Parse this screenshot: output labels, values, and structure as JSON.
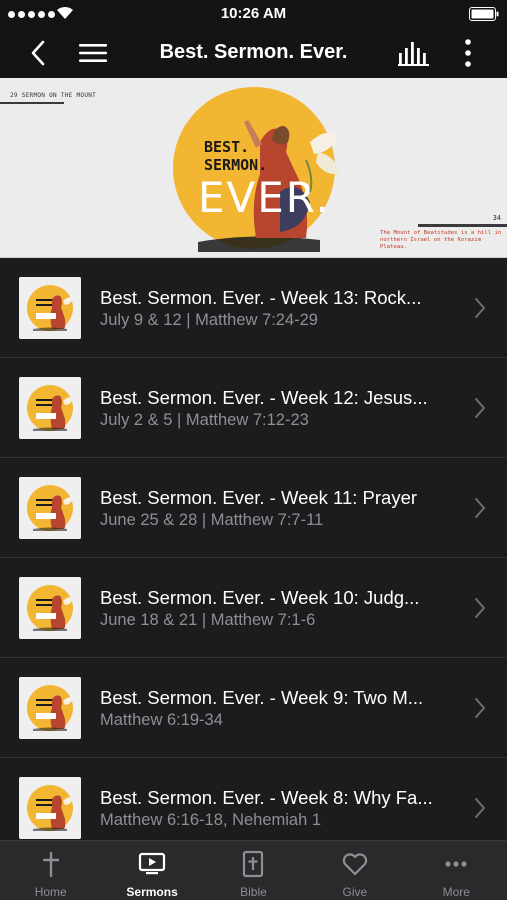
{
  "status_bar": {
    "time": "10:26 AM"
  },
  "nav": {
    "title": "Best. Sermon. Ever.",
    "back_icon": "chevron-left-icon",
    "menu_icon": "hamburger-icon",
    "chart_icon": "bars-icon",
    "more_icon": "vertical-dots-icon"
  },
  "banner": {
    "series_tag": "29 SERMON ON THE MOUNT",
    "art_line1": "BEST.",
    "art_line2": "SERMON.",
    "art_line3": "EVER.",
    "page_number": "34",
    "caption": "The Mount of Beatitudes is a hill in northern Israel on the Korazim Plateau.",
    "accent_color": "#f2b632"
  },
  "sermons": [
    {
      "title": "Best. Sermon. Ever. - Week 13: Rock...",
      "subtitle": "July 9 & 12 | Matthew 7:24-29"
    },
    {
      "title": "Best. Sermon. Ever. - Week 12: Jesus...",
      "subtitle": "July 2 & 5 | Matthew 7:12-23"
    },
    {
      "title": "Best. Sermon. Ever. - Week 11: Prayer",
      "subtitle": "June 25 & 28 | Matthew 7:7-11"
    },
    {
      "title": "Best. Sermon. Ever. - Week 10: Judg...",
      "subtitle": "June 18 & 21 | Matthew 7:1-6"
    },
    {
      "title": "Best. Sermon. Ever. - Week 9: Two M...",
      "subtitle": "Matthew 6:19-34"
    },
    {
      "title": "Best. Sermon. Ever. - Week 8: Why Fa...",
      "subtitle": "Matthew 6:16-18,  Nehemiah 1"
    }
  ],
  "tabs": [
    {
      "label": "Home",
      "icon": "cross-icon",
      "active": false
    },
    {
      "label": "Sermons",
      "icon": "tv-play-icon",
      "active": true
    },
    {
      "label": "Bible",
      "icon": "bible-icon",
      "active": false
    },
    {
      "label": "Give",
      "icon": "heart-icon",
      "active": false
    },
    {
      "label": "More",
      "icon": "more-dots-icon",
      "active": false
    }
  ]
}
